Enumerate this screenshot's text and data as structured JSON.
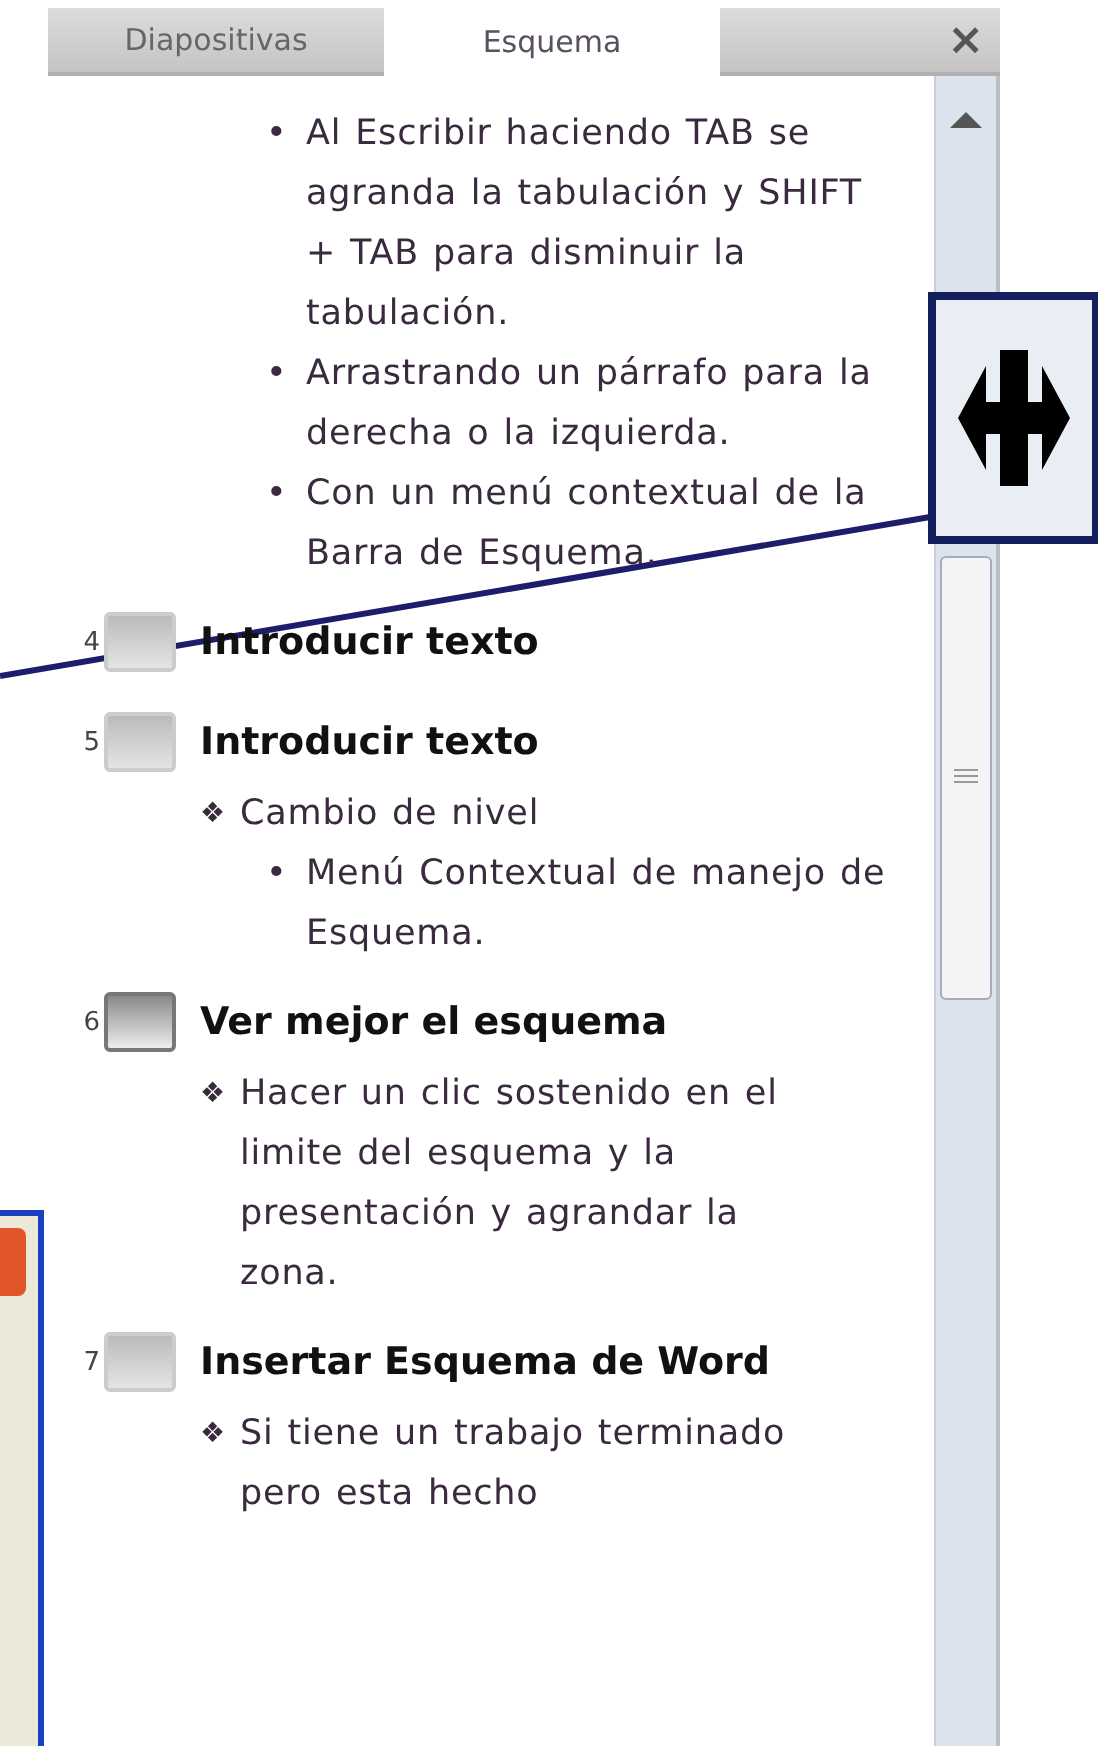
{
  "tabs": [
    {
      "label": "Diapositivas",
      "selected": false
    },
    {
      "label": "Esquema",
      "selected": true
    }
  ],
  "close_button": "×",
  "outline": [
    {
      "kind": "continuation",
      "children": [
        {
          "marker": "•",
          "text": "Al Escribir haciendo TAB se agranda la tabulación y SHIFT + TAB para disminuir la tabulación."
        },
        {
          "marker": "•",
          "text": "Arrastrando un párrafo para la derecha o la izquierda."
        },
        {
          "marker": "•",
          "text": "Con un menú contextual de la Barra de Esquema."
        }
      ]
    },
    {
      "kind": "slide",
      "number": "4",
      "title": "Introducir texto",
      "selected": false
    },
    {
      "kind": "slide",
      "number": "5",
      "title": "Introducir texto",
      "selected": false,
      "children": [
        {
          "marker": "❖",
          "text": "Cambio de nivel",
          "children": [
            {
              "marker": "•",
              "text": "Menú Contextual de manejo de Esquema."
            }
          ]
        }
      ]
    },
    {
      "kind": "slide",
      "number": "6",
      "title": "Ver mejor el esquema",
      "selected": true,
      "children": [
        {
          "marker": "❖",
          "text": "Hacer un clic sostenido en el limite del esquema y la presentación y agrandar la zona."
        }
      ]
    },
    {
      "kind": "slide",
      "number": "7",
      "title": "Insertar Esquema de Word",
      "selected": false,
      "children": [
        {
          "marker": "❖",
          "text": "Si tiene un trabajo terminado pero esta hecho"
        }
      ]
    }
  ]
}
